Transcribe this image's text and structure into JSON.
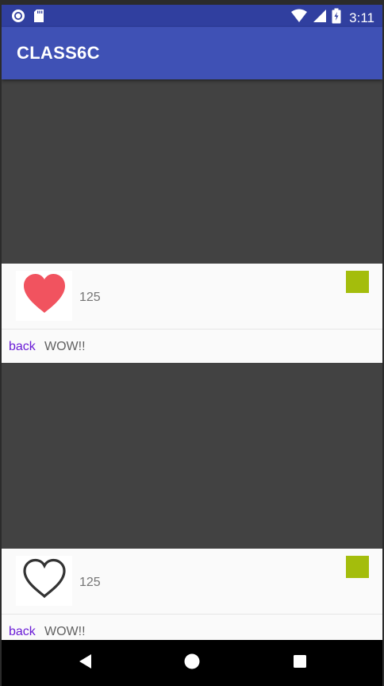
{
  "status_bar": {
    "time": "3:11",
    "left_icons": [
      "record-icon",
      "sd-card-icon"
    ],
    "right_icons": [
      "wifi-icon",
      "signal-icon",
      "battery-charging-icon"
    ]
  },
  "app_bar": {
    "title": "CLASS6C"
  },
  "posts": [
    {
      "like_icon": "heart-filled-icon",
      "like_count": "125",
      "back_label": "back",
      "comment": "WOW!!"
    },
    {
      "like_icon": "heart-outline-icon",
      "like_count": "125",
      "back_label": "back",
      "comment": "WOW!!"
    }
  ],
  "nav_bar": {
    "buttons": [
      "back-triangle-icon",
      "home-circle-icon",
      "recents-square-icon"
    ]
  },
  "colors": {
    "status_bar": "#303f9f",
    "app_bar": "#3f51b5",
    "image_placeholder": "#424242",
    "heart_filled": "#f1535f",
    "badge_green": "#a4bd0c",
    "link_purple": "#6a1bd6"
  }
}
